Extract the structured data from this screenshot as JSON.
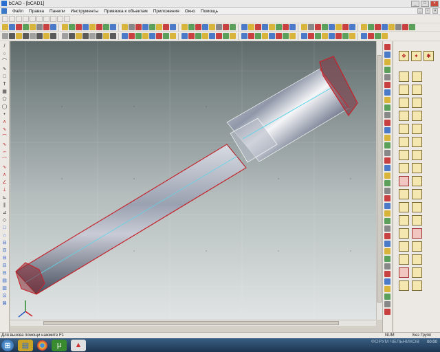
{
  "window": {
    "title": "bCAD - [bCAD1]"
  },
  "menu": {
    "items": [
      "Файл",
      "Правка",
      "Панели",
      "Инструменты",
      "Привязка к объектам",
      "Приложения",
      "Окно",
      "Помощь"
    ]
  },
  "toolbars": {
    "row1_colors": [
      "#d9b43a",
      "#4a7ac8",
      "#c84040",
      "#5aa05a",
      "#d9b43a",
      "#888888",
      "#c84040",
      "#4a7ac8",
      "#d9b43a",
      "#5aa05a",
      "#c84040",
      "#4a7ac8",
      "#d9b43a",
      "#c84040",
      "#5aa05a",
      "#4a7ac8",
      "#d9b43a",
      "#888888",
      "#c84040",
      "#4a7ac8",
      "#5aa05a",
      "#d9b43a",
      "#c84040",
      "#4a7ac8",
      "#d9b43a",
      "#5aa05a",
      "#c84040",
      "#4a7ac8",
      "#d9b43a",
      "#888888",
      "#c84040",
      "#5aa05a",
      "#4a7ac8",
      "#d9b43a",
      "#c84040",
      "#4a7ac8",
      "#d9b43a",
      "#5aa05a",
      "#c84040",
      "#4a7ac8",
      "#d9b43a",
      "#888888",
      "#c84040",
      "#5aa05a",
      "#4a7ac8",
      "#d9b43a",
      "#c84040",
      "#4a7ac8",
      "#d9b43a",
      "#5aa05a",
      "#c84040",
      "#4a7ac8",
      "#d9b43a",
      "#888888",
      "#c84040",
      "#5aa05a"
    ],
    "row2_colors": [
      "#a0a0a0",
      "#5a5a5a",
      "#d9b43a",
      "#5a5a5a",
      "#a0a0a0",
      "#5a5a5a",
      "#d9b43a",
      "#5a5a5a",
      "#a0a0a0",
      "#5a5a5a",
      "#d9b43a",
      "#5a5a5a",
      "#a0a0a0",
      "#5a5a5a",
      "#d9b43a",
      "#5a5a5a",
      "#4a7ac8",
      "#c84040",
      "#5aa05a",
      "#d9b43a",
      "#4a7ac8",
      "#c84040",
      "#5aa05a",
      "#d9b43a",
      "#4a7ac8",
      "#c84040",
      "#5aa05a",
      "#d9b43a",
      "#4a7ac8",
      "#c84040",
      "#5aa05a",
      "#d9b43a",
      "#4a7ac8",
      "#c84040",
      "#5aa05a",
      "#d9b43a",
      "#4a7ac8",
      "#c84040",
      "#5aa05a",
      "#d9b43a",
      "#4a7ac8",
      "#c84040",
      "#5aa05a",
      "#d9b43a",
      "#4a7ac8",
      "#c84040",
      "#5aa05a",
      "#d9b43a",
      "#4a7ac8",
      "#c84040",
      "#5aa05a",
      "#d9b43a"
    ]
  },
  "left_tools": [
    "/",
    "○",
    "⌒",
    "∿",
    "□",
    "T",
    "▦",
    "⬠",
    "◯",
    "•",
    "∧",
    "∿",
    "⌒",
    "∿",
    "∽",
    "⌒",
    "∿",
    "∧",
    "∠",
    "⊥",
    "⊾",
    "∥",
    "⊿",
    "◇",
    "□",
    "⌂",
    "⊟",
    "⊟",
    "⊟",
    "⊟",
    "⊟",
    "▤",
    "▥",
    "⊡",
    "⊠"
  ],
  "right_panel": {
    "cells": 34
  },
  "status": {
    "help_text": "Для вызова помощи нажмите F1",
    "num": "NUM",
    "group": "Без Групп"
  },
  "taskbar": {
    "clock": "00:00",
    "watermark": "ФОРУМ ЧЕЛЬНИКОВ"
  }
}
